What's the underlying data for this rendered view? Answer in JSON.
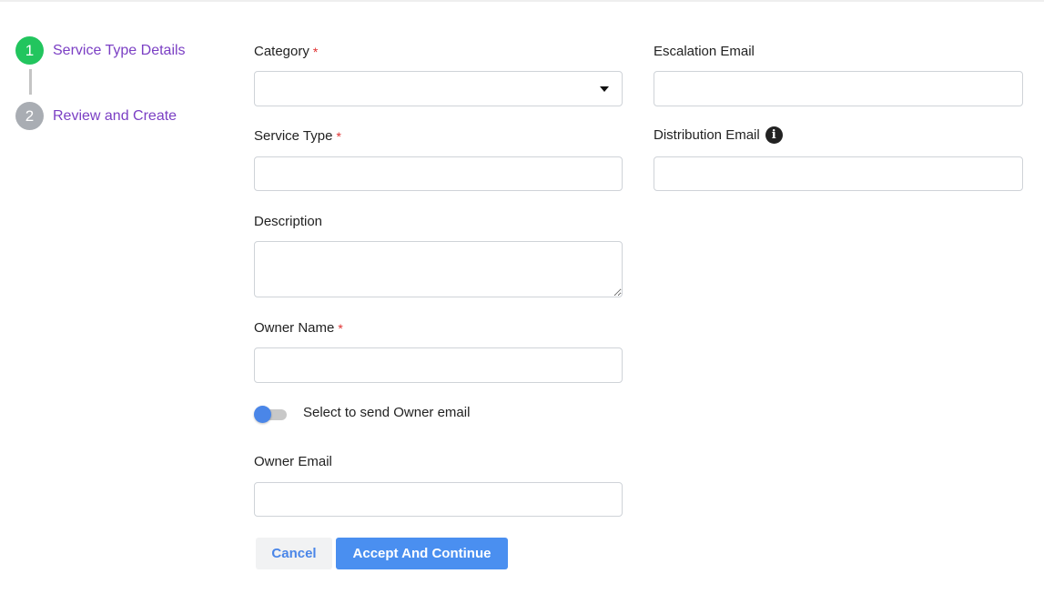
{
  "stepper": {
    "steps": [
      {
        "number": "1",
        "label": "Service Type Details",
        "status": "active"
      },
      {
        "number": "2",
        "label": "Review and Create",
        "status": "inactive"
      }
    ]
  },
  "form": {
    "category": {
      "label": "Category",
      "required_mark": "*",
      "value": ""
    },
    "service_type": {
      "label": "Service Type",
      "required_mark": "*",
      "value": ""
    },
    "description": {
      "label": "Description",
      "value": ""
    },
    "owner_name": {
      "label": "Owner Name",
      "required_mark": "*",
      "value": ""
    },
    "owner_email_toggle": {
      "label": "Select to send Owner email",
      "checked": false
    },
    "owner_email": {
      "label": "Owner Email",
      "value": ""
    },
    "escalation_email": {
      "label": "Escalation Email",
      "value": ""
    },
    "distribution_email": {
      "label": "Distribution Email",
      "info_icon": "i",
      "value": ""
    }
  },
  "actions": {
    "cancel_label": "Cancel",
    "accept_label": "Accept And Continue"
  },
  "colors": {
    "accent": "#4a8ff0",
    "step_active": "#22c55e",
    "step_inactive": "#a9adb3",
    "step_label": "#7b3fc4",
    "required": "#e03131"
  }
}
